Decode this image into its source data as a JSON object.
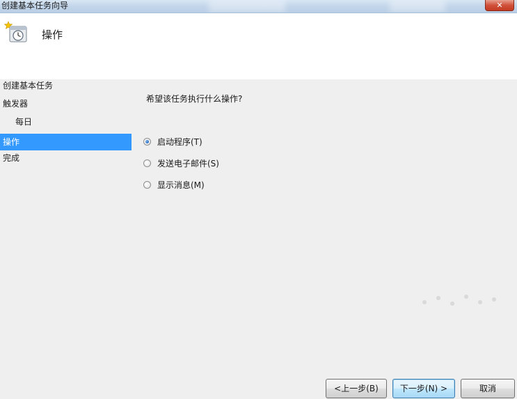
{
  "window": {
    "title": "创建基本任务向导",
    "close_symbol": "✕"
  },
  "header": {
    "title": "操作",
    "icon": "task-scheduler-icon"
  },
  "steps": [
    {
      "label": "创建基本任务",
      "active": false
    },
    {
      "label": "触发器",
      "active": false
    },
    {
      "label": "每日",
      "active": false
    },
    {
      "label": "操作",
      "active": true
    },
    {
      "label": "完成",
      "active": false
    }
  ],
  "question": "希望该任务执行什么操作?",
  "options": [
    {
      "label": "启动程序(T)",
      "selected": true
    },
    {
      "label": "发送电子邮件(S)",
      "selected": false
    },
    {
      "label": "显示消息(M)",
      "selected": false
    }
  ],
  "buttons": {
    "back": "<上一步(B)",
    "next": "下一步(N) >",
    "cancel": "取消"
  },
  "colors": {
    "active_step": "#3399ff",
    "header_bg": "#ffffff",
    "body_bg": "#efefef"
  }
}
